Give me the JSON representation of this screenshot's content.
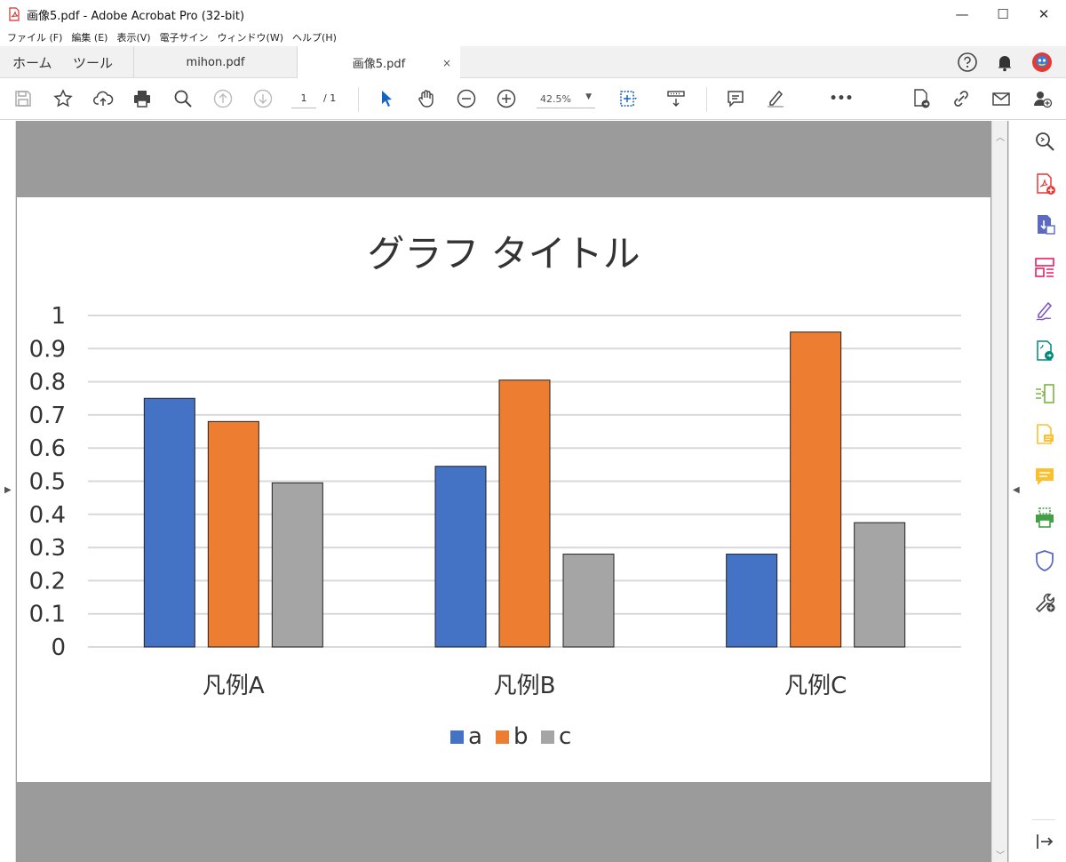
{
  "window": {
    "title": "画像5.pdf - Adobe Acrobat Pro (32-bit)",
    "controls": [
      "—",
      "☐",
      "✕"
    ]
  },
  "menu": [
    "ファイル (F)",
    "編集 (E)",
    "表示(V)",
    "電子サイン",
    "ウィンドウ(W)",
    "ヘルプ(H)"
  ],
  "nav": {
    "home": "ホーム",
    "tools": "ツール"
  },
  "tabs": [
    {
      "label": "mihon.pdf"
    },
    {
      "label": "画像5.pdf",
      "close": "×"
    }
  ],
  "toolbar": {
    "page_current": "1",
    "page_total": "/  1",
    "zoom": "42.5%",
    "more": "•••"
  },
  "chart_data": {
    "type": "bar",
    "title": "グラフ タイトル",
    "categories": [
      "凡例A",
      "凡例B",
      "凡例C"
    ],
    "series": [
      {
        "name": "a",
        "color": "#4472c4",
        "values": [
          0.75,
          0.545,
          0.28
        ]
      },
      {
        "name": "b",
        "color": "#ed7d31",
        "values": [
          0.68,
          0.805,
          0.95
        ]
      },
      {
        "name": "c",
        "color": "#a5a5a5",
        "values": [
          0.495,
          0.28,
          0.375
        ]
      }
    ],
    "ylim": [
      0,
      1
    ],
    "yticks": [
      "0",
      "0.1",
      "0.2",
      "0.3",
      "0.4",
      "0.5",
      "0.6",
      "0.7",
      "0.8",
      "0.9",
      "1"
    ],
    "grid": true,
    "legend_position": "bottom"
  }
}
